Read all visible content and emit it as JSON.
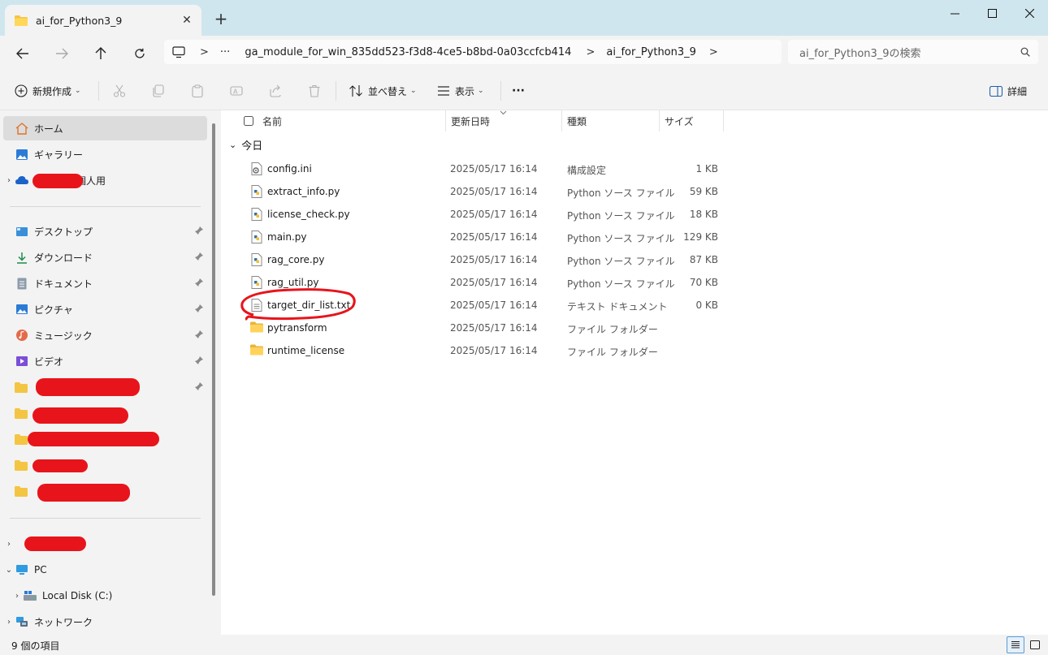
{
  "window": {
    "tab_title": "ai_for_Python3_9",
    "tab_close": "✕",
    "new_tab": "+"
  },
  "address": {
    "ellipsis": "···",
    "crumbs": [
      "ga_module_for_win_835dd523-f3d8-4ce5-b8bd-0a03ccfcb414",
      "ai_for_Python3_9"
    ],
    "sep": ">",
    "search_placeholder": "ai_for_Python3_9の検索"
  },
  "toolbar": {
    "new_label": "新規作成",
    "sort_label": "並べ替え",
    "view_label": "表示",
    "more_label": "···",
    "details_label": "詳細"
  },
  "sidebar": {
    "home": "ホーム",
    "gallery": "ギャラリー",
    "personal": "個人用",
    "quick": [
      {
        "label": "デスクトップ",
        "icon": "desktop-icon"
      },
      {
        "label": "ダウンロード",
        "icon": "download-icon"
      },
      {
        "label": "ドキュメント",
        "icon": "documents-icon"
      },
      {
        "label": "ピクチャ",
        "icon": "pictures-icon"
      },
      {
        "label": "ミュージック",
        "icon": "music-icon"
      },
      {
        "label": "ビデオ",
        "icon": "video-icon"
      }
    ],
    "pc": "PC",
    "local_disk": "Local Disk (C:)",
    "network": "ネットワーク"
  },
  "columns": {
    "name": "名前",
    "date": "更新日時",
    "type": "種類",
    "size": "サイズ"
  },
  "group_label": "今日",
  "files": [
    {
      "name": "config.ini",
      "date": "2025/05/17 16:14",
      "type": "構成設定",
      "size": "1 KB",
      "icon": "config-file-icon"
    },
    {
      "name": "extract_info.py",
      "date": "2025/05/17 16:14",
      "type": "Python ソース ファイル",
      "size": "59 KB",
      "icon": "python-file-icon"
    },
    {
      "name": "license_check.py",
      "date": "2025/05/17 16:14",
      "type": "Python ソース ファイル",
      "size": "18 KB",
      "icon": "python-file-icon"
    },
    {
      "name": "main.py",
      "date": "2025/05/17 16:14",
      "type": "Python ソース ファイル",
      "size": "129 KB",
      "icon": "python-file-icon"
    },
    {
      "name": "rag_core.py",
      "date": "2025/05/17 16:14",
      "type": "Python ソース ファイル",
      "size": "87 KB",
      "icon": "python-file-icon"
    },
    {
      "name": "rag_util.py",
      "date": "2025/05/17 16:14",
      "type": "Python ソース ファイル",
      "size": "70 KB",
      "icon": "python-file-icon"
    },
    {
      "name": "target_dir_list.txt",
      "date": "2025/05/17 16:14",
      "type": "テキスト ドキュメント",
      "size": "0 KB",
      "icon": "text-file-icon"
    },
    {
      "name": "pytransform",
      "date": "2025/05/17 16:14",
      "type": "ファイル フォルダー",
      "size": "",
      "icon": "folder-icon"
    },
    {
      "name": "runtime_license",
      "date": "2025/05/17 16:14",
      "type": "ファイル フォルダー",
      "size": "",
      "icon": "folder-icon"
    }
  ],
  "status": {
    "item_count": "9 個の項目"
  },
  "colors": {
    "title_bar": "#cfe6ee",
    "chrome": "#f3f3f3",
    "folder": "#f4c542",
    "redaction": "#e8141b"
  }
}
